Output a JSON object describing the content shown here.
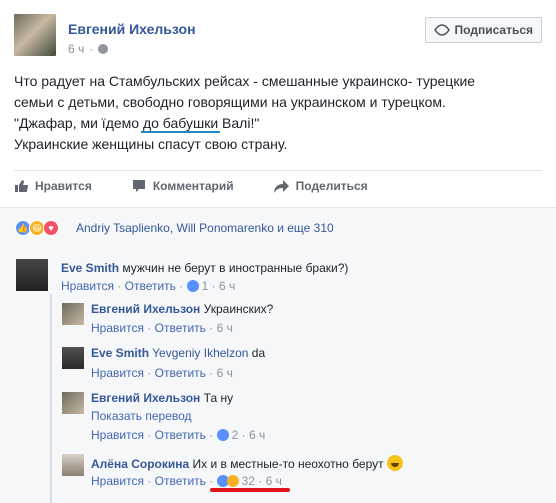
{
  "post": {
    "author": "Евгений Ихельзон",
    "time": "6 ч",
    "subscribe_label": "Подписаться",
    "text_lines": [
      "Что радует на Стамбульских рейсах - смешанные украинско- турецкие",
      "семьи с детьми, свободно говорящими на украинском и турецком."
    ],
    "quote_before": "\"Джафар, ми їдемо ",
    "quote_highlight": "до бабушки",
    "quote_after": " Валі!\"",
    "last_line": "Украинские женщины спасут свою страну."
  },
  "actions": {
    "like": "Нравится",
    "comment": "Комментарий",
    "share": "Поделиться"
  },
  "reactions": {
    "names": "Andriy Tsaplienko, Will Ponomarenko и еще 310"
  },
  "comments": [
    {
      "author": "Eve Smith",
      "text": "мужчин не берут в иностранные браки?)",
      "like": "Нравится",
      "reply": "Ответить",
      "sep": "·",
      "count": "1",
      "time": "6 ч"
    },
    {
      "author": "Евгений Ихельзон",
      "text": "Украинских?",
      "like": "Нравится",
      "reply": "Ответить",
      "sep": "·",
      "time": "6 ч"
    },
    {
      "author": "Eve Smith",
      "tag": "Yevgeniy Ikhelzon",
      "text": "da",
      "like": "Нравится",
      "reply": "Ответить",
      "sep": "·",
      "time": "6 ч"
    },
    {
      "author": "Евгений Ихельзон",
      "text": "Та ну",
      "translate": "Показать перевод",
      "like": "Нравится",
      "reply": "Ответить",
      "sep": "·",
      "count": "2",
      "time": "6 ч"
    },
    {
      "author": "Алёна Сорокина",
      "text": "Их и в местные-то неохотно берут",
      "like": "Нравится",
      "reply": "Ответить",
      "sep": "·",
      "count": "32",
      "time": "6 ч"
    }
  ],
  "colors": {
    "link": "#365899",
    "accent": "#1e88c8",
    "mark": "#e0151b"
  }
}
